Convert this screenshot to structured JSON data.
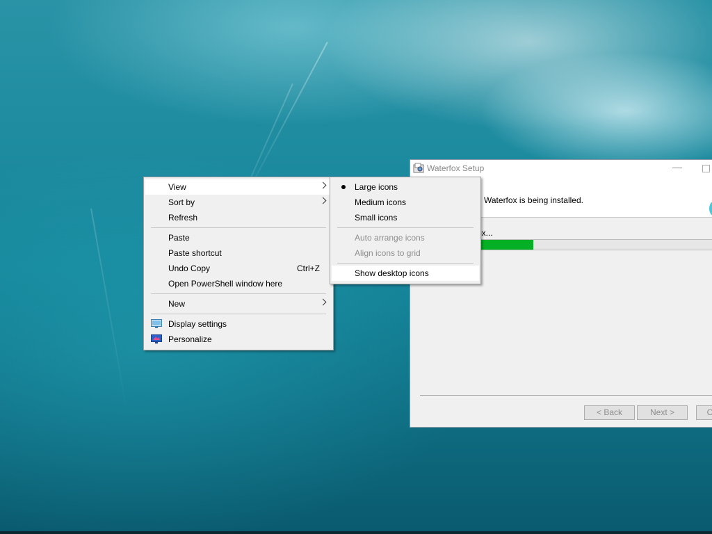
{
  "setup_window": {
    "title": "Waterfox Setup",
    "minimize_glyph": "—",
    "header_text": "Waterfox is being installed.",
    "status_text": "ox...",
    "progress_fraction": 0.25,
    "back_label": "< Back",
    "next_label": "Next >",
    "cancel_label": "C",
    "progress_color": "#06b025"
  },
  "context_menu": {
    "items": [
      {
        "label": "View",
        "submenu": true
      },
      {
        "label": "Sort by",
        "submenu": true
      },
      {
        "label": "Refresh"
      },
      {
        "label": "Paste"
      },
      {
        "label": "Paste shortcut"
      },
      {
        "label": "Undo Copy",
        "shortcut": "Ctrl+Z"
      },
      {
        "label": "Open PowerShell window here"
      },
      {
        "label": "New",
        "submenu": true
      },
      {
        "label": "Display settings",
        "icon": "display-icon"
      },
      {
        "label": "Personalize",
        "icon": "personalize-icon"
      }
    ]
  },
  "view_submenu": {
    "items": [
      {
        "label": "Large icons",
        "selected": true
      },
      {
        "label": "Medium icons"
      },
      {
        "label": "Small icons"
      },
      {
        "label": "Auto arrange icons",
        "disabled": true
      },
      {
        "label": "Align icons to grid",
        "disabled": true
      },
      {
        "label": "Show desktop icons"
      }
    ]
  }
}
